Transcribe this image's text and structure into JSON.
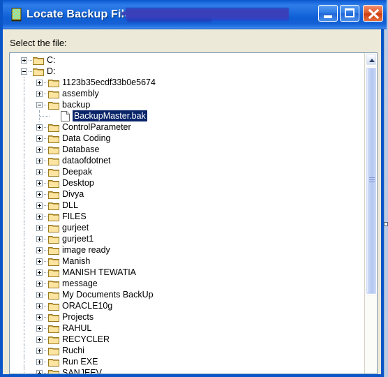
{
  "window": {
    "title_prefix": "Locate Backup File - ",
    "title_redacted": "",
    "icon": "database-cylinder-icon",
    "controls": {
      "minimize_label": "",
      "maximize_label": "",
      "close_label": ""
    }
  },
  "dialog": {
    "prompt_label": "Select the file:"
  },
  "tree": {
    "selected_item": "BackupMaster.bak",
    "selection_color": "#0a246a",
    "items": [
      {
        "label": "C:",
        "level": 0,
        "type": "drive",
        "state": "collapsed",
        "selected": false
      },
      {
        "label": "D:",
        "level": 0,
        "type": "drive",
        "state": "expanded",
        "selected": false
      },
      {
        "label": "1123b35ecdf33b0e5674",
        "level": 1,
        "type": "folder",
        "state": "collapsed",
        "selected": false
      },
      {
        "label": "assembly",
        "level": 1,
        "type": "folder",
        "state": "collapsed",
        "selected": false
      },
      {
        "label": "backup",
        "level": 1,
        "type": "folder",
        "state": "expanded",
        "selected": false
      },
      {
        "label": "BackupMaster.bak",
        "level": 2,
        "type": "file",
        "state": "leaf",
        "selected": true
      },
      {
        "label": "ControlParameter",
        "level": 1,
        "type": "folder",
        "state": "collapsed",
        "selected": false
      },
      {
        "label": "Data Coding",
        "level": 1,
        "type": "folder",
        "state": "collapsed",
        "selected": false
      },
      {
        "label": "Database",
        "level": 1,
        "type": "folder",
        "state": "collapsed",
        "selected": false
      },
      {
        "label": "dataofdotnet",
        "level": 1,
        "type": "folder",
        "state": "collapsed",
        "selected": false
      },
      {
        "label": "Deepak",
        "level": 1,
        "type": "folder",
        "state": "collapsed",
        "selected": false
      },
      {
        "label": "Desktop",
        "level": 1,
        "type": "folder",
        "state": "collapsed",
        "selected": false
      },
      {
        "label": "Divya",
        "level": 1,
        "type": "folder",
        "state": "collapsed",
        "selected": false
      },
      {
        "label": "DLL",
        "level": 1,
        "type": "folder",
        "state": "collapsed",
        "selected": false
      },
      {
        "label": "FILES",
        "level": 1,
        "type": "folder",
        "state": "collapsed",
        "selected": false
      },
      {
        "label": "gurjeet",
        "level": 1,
        "type": "folder",
        "state": "collapsed",
        "selected": false
      },
      {
        "label": "gurjeet1",
        "level": 1,
        "type": "folder",
        "state": "collapsed",
        "selected": false
      },
      {
        "label": "image ready",
        "level": 1,
        "type": "folder",
        "state": "collapsed",
        "selected": false
      },
      {
        "label": "Manish",
        "level": 1,
        "type": "folder",
        "state": "collapsed",
        "selected": false
      },
      {
        "label": "MANISH TEWATIA",
        "level": 1,
        "type": "folder",
        "state": "collapsed",
        "selected": false
      },
      {
        "label": "message",
        "level": 1,
        "type": "folder",
        "state": "collapsed",
        "selected": false
      },
      {
        "label": "My Documents BackUp",
        "level": 1,
        "type": "folder",
        "state": "collapsed",
        "selected": false
      },
      {
        "label": "ORACLE10g",
        "level": 1,
        "type": "folder",
        "state": "collapsed",
        "selected": false
      },
      {
        "label": "Projects",
        "level": 1,
        "type": "folder",
        "state": "collapsed",
        "selected": false
      },
      {
        "label": "RAHUL",
        "level": 1,
        "type": "folder",
        "state": "collapsed",
        "selected": false
      },
      {
        "label": "RECYCLER",
        "level": 1,
        "type": "folder",
        "state": "collapsed",
        "selected": false
      },
      {
        "label": "Ruchi",
        "level": 1,
        "type": "folder",
        "state": "collapsed",
        "selected": false
      },
      {
        "label": "Run EXE",
        "level": 1,
        "type": "folder",
        "state": "collapsed",
        "selected": false
      },
      {
        "label": "SANJEEV",
        "level": 1,
        "type": "folder",
        "state": "collapsed",
        "selected": false
      }
    ]
  },
  "scrollbar": {
    "up_arrow": "scroll-up-arrow",
    "thumb_grip": "scrollbar-grip"
  },
  "colors": {
    "titlebar_blue": "#0a55c8",
    "dialog_face": "#ECE9D8",
    "folder_yellow": "#FCD77A",
    "selection_blue": "#0a246a",
    "close_red": "#e05c2c"
  }
}
